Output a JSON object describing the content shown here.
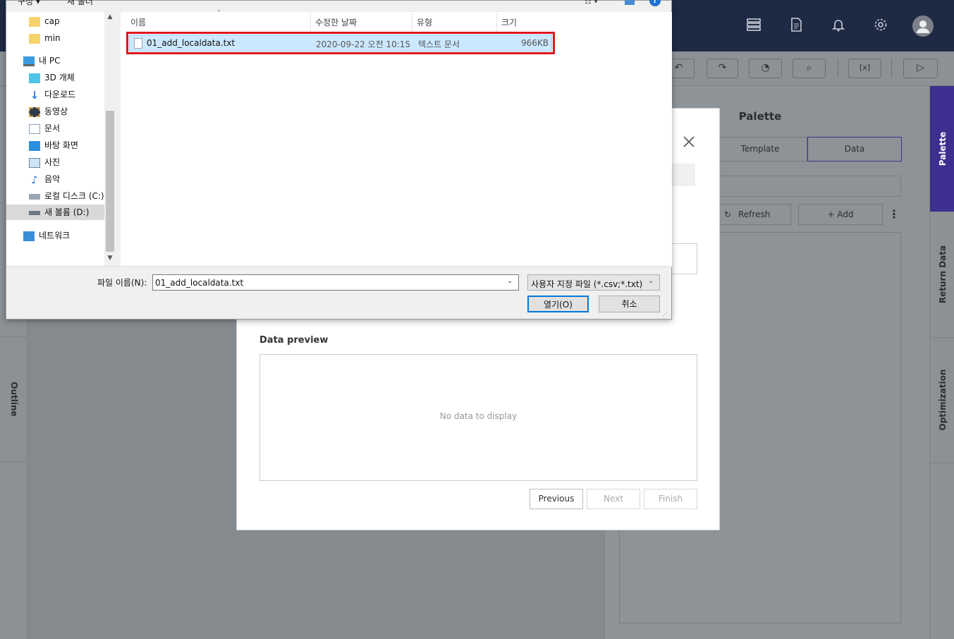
{
  "appbar": {
    "icons": [
      "server-icon",
      "document-icon",
      "bell-icon",
      "gear-icon",
      "user-icon"
    ]
  },
  "toolbar": {
    "icons": [
      "undo-icon",
      "redo-icon",
      "history-icon",
      "search-document-icon",
      "variable-icon",
      "play-icon"
    ]
  },
  "left_tabs": {
    "outline": "Outline"
  },
  "right_tabs": {
    "palette": "Palette",
    "return_data": "Return Data",
    "optimization": "Optimization"
  },
  "palette": {
    "title": "Palette",
    "tabs": [
      "Template",
      "Data"
    ],
    "refresh_label": "Refresh",
    "add_label": "+ Add"
  },
  "wizard": {
    "data_preview_title": "Data preview",
    "empty_text": "No data to display",
    "previous_label": "Previous",
    "next_label": "Next",
    "finish_label": "Finish"
  },
  "file_dialog": {
    "top_partial": {
      "organize": "구성 ▾",
      "new_folder": "새 폴더"
    },
    "nav_items": [
      {
        "label": "cap",
        "icon": "folder-icon"
      },
      {
        "label": "min",
        "icon": "folder-icon"
      },
      {
        "label": "내 PC",
        "icon": "computer-icon"
      },
      {
        "label": "3D 개체",
        "icon": "cube-icon"
      },
      {
        "label": "다운로드",
        "icon": "download-icon"
      },
      {
        "label": "동영상",
        "icon": "film-icon"
      },
      {
        "label": "문서",
        "icon": "document-icon"
      },
      {
        "label": "바탕 화면",
        "icon": "desktop-icon"
      },
      {
        "label": "사진",
        "icon": "picture-icon"
      },
      {
        "label": "음악",
        "icon": "music-icon"
      },
      {
        "label": "로컬 디스크 (C:)",
        "icon": "drive-icon"
      },
      {
        "label": "새 볼륨 (D:)",
        "icon": "drive-icon"
      },
      {
        "label": "네트워크",
        "icon": "network-icon"
      }
    ],
    "columns": [
      "이름",
      "수정한 날짜",
      "유형",
      "크기"
    ],
    "files": [
      {
        "name": "01_add_localdata.txt",
        "date": "2020-09-22 오전 10:15",
        "type": "텍스트 문서",
        "size": "966KB"
      }
    ],
    "filename_label": "파일 이름(N):",
    "filename_value": "01_add_localdata.txt",
    "filter_value": "사용자 지정 파일 (*.csv;*.txt)",
    "open_label": "열기(O)",
    "cancel_label": "취소"
  },
  "colors": {
    "appbar_bg": "#1e2a44",
    "highlight_red": "#e0161d",
    "selected_row": "#cce8ff",
    "palette_active": "#3d2f8f"
  }
}
